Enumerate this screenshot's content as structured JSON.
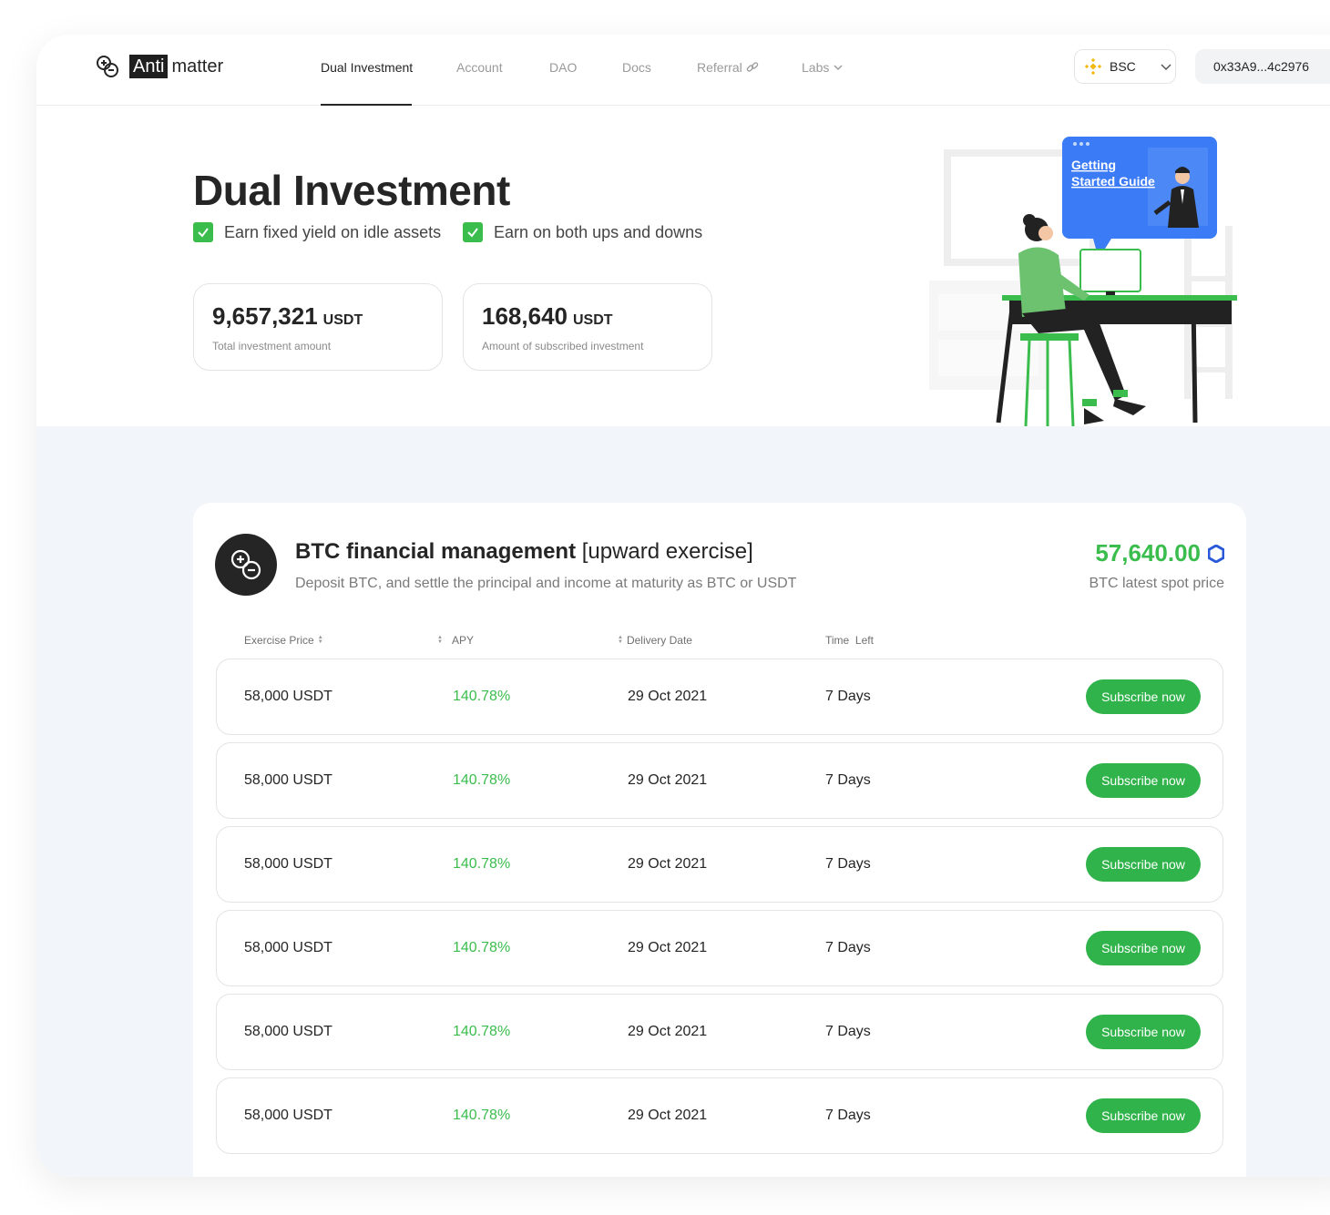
{
  "brand": {
    "anti": "Anti",
    "matter": "matter"
  },
  "nav": {
    "items": [
      {
        "label": "Dual Investment"
      },
      {
        "label": "Account"
      },
      {
        "label": "DAO"
      },
      {
        "label": "Docs"
      },
      {
        "label": "Referral"
      },
      {
        "label": "Labs"
      }
    ]
  },
  "header": {
    "chain": "BSC",
    "address": "0x33A9...4c2976"
  },
  "hero": {
    "title": "Dual Investment",
    "features": [
      "Earn fixed yield on idle assets",
      "Earn on both ups and downs"
    ],
    "stats": [
      {
        "value": "9,657,321",
        "unit": "USDT",
        "label": "Total investment amount"
      },
      {
        "value": "168,640",
        "unit": "USDT",
        "label": "Amount of subscribed investment"
      }
    ],
    "guide": {
      "line1": "Getting",
      "line2": "Started Guide"
    }
  },
  "product": {
    "title_bold": "BTC financial management",
    "title_tag": "[upward exercise]",
    "subtitle": "Deposit BTC, and settle the principal and income at maturity as BTC or USDT",
    "price": "57,640.00",
    "price_label": "BTC latest spot price"
  },
  "table": {
    "headers": {
      "exercise": "Exercise Price",
      "apy": "APY",
      "delivery": "Delivery Date",
      "time": "Time  Left"
    },
    "rows": [
      {
        "price": "58,000 USDT",
        "apy": "140.78%",
        "date": "29 Oct 2021",
        "time": "7 Days",
        "action": "Subscribe now"
      },
      {
        "price": "58,000 USDT",
        "apy": "140.78%",
        "date": "29 Oct 2021",
        "time": "7 Days",
        "action": "Subscribe now"
      },
      {
        "price": "58,000 USDT",
        "apy": "140.78%",
        "date": "29 Oct 2021",
        "time": "7 Days",
        "action": "Subscribe now"
      },
      {
        "price": "58,000 USDT",
        "apy": "140.78%",
        "date": "29 Oct 2021",
        "time": "7 Days",
        "action": "Subscribe now"
      },
      {
        "price": "58,000 USDT",
        "apy": "140.78%",
        "date": "29 Oct 2021",
        "time": "7 Days",
        "action": "Subscribe now"
      },
      {
        "price": "58,000 USDT",
        "apy": "140.78%",
        "date": "29 Oct 2021",
        "time": "7 Days",
        "action": "Subscribe now"
      }
    ]
  },
  "colors": {
    "accent": "#3abd4d",
    "button": "#30b34a",
    "guide": "#3b7bf6",
    "text": "#252525",
    "chain_icon": "#f0b90b",
    "price_icon": "#2a5ada"
  },
  "icons": {
    "check": "check-icon",
    "chevron": "chevron-down-icon",
    "link": "link-icon",
    "chain": "bnb-icon",
    "price": "chainlink-icon"
  }
}
